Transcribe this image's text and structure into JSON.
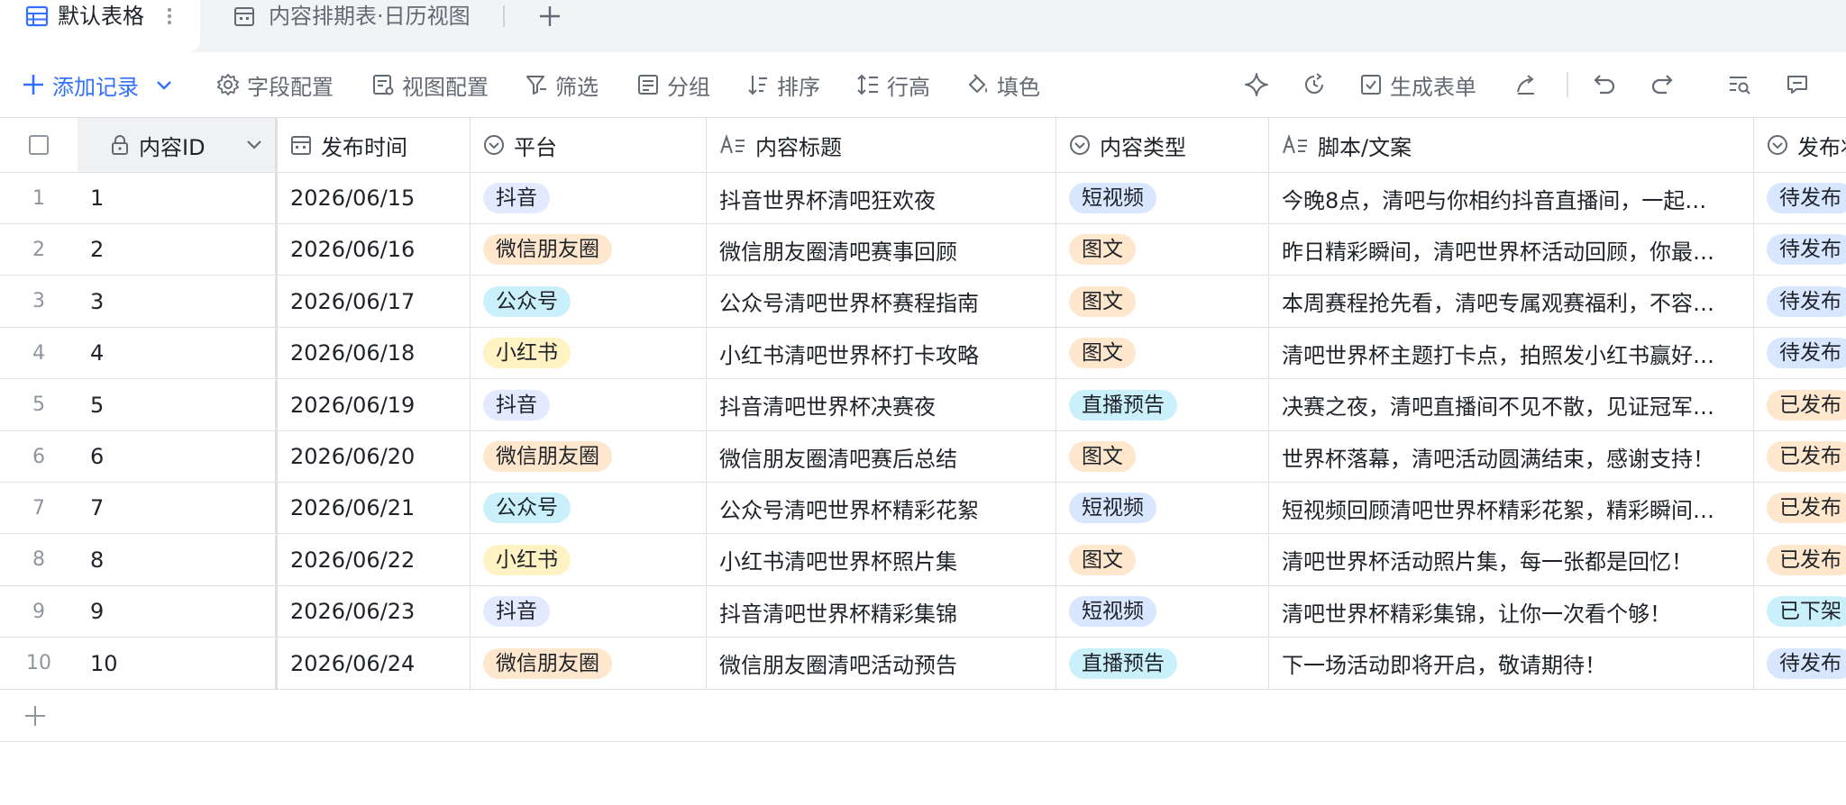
{
  "tabs": {
    "active_label": "默认表格",
    "second_label": "内容排期表·日历视图"
  },
  "toolbar": {
    "add_record": "添加记录",
    "field_config": "字段配置",
    "view_config": "视图配置",
    "filter": "筛选",
    "group": "分组",
    "sort": "排序",
    "row_height": "行高",
    "fill": "填色",
    "generate_form": "生成表单"
  },
  "columns": {
    "id": "内容ID",
    "date": "发布时间",
    "platform": "平台",
    "title": "内容标题",
    "type": "内容类型",
    "script": "脚本/文案",
    "status": "发布状态"
  },
  "colors": {
    "accent": "#3370ff",
    "tag_douyin": "#e1eaff",
    "tag_wechat": "#fee7cd",
    "tag_gzh": "#caf0fb",
    "tag_xhs": "#fff3c4"
  },
  "rows": [
    {
      "num": "1",
      "id": "1",
      "date": "2026/06/15",
      "platform": "抖音",
      "title": "抖音世界杯清吧狂欢夜",
      "type": "短视频",
      "script": "今晚8点，清吧与你相约抖音直播间，一起…",
      "status": "待发布"
    },
    {
      "num": "2",
      "id": "2",
      "date": "2026/06/16",
      "platform": "微信朋友圈",
      "title": "微信朋友圈清吧赛事回顾",
      "type": "图文",
      "script": "昨日精彩瞬间，清吧世界杯活动回顾，你最…",
      "status": "待发布"
    },
    {
      "num": "3",
      "id": "3",
      "date": "2026/06/17",
      "platform": "公众号",
      "title": "公众号清吧世界杯赛程指南",
      "type": "图文",
      "script": "本周赛程抢先看，清吧专属观赛福利，不容…",
      "status": "待发布"
    },
    {
      "num": "4",
      "id": "4",
      "date": "2026/06/18",
      "platform": "小红书",
      "title": "小红书清吧世界杯打卡攻略",
      "type": "图文",
      "script": "清吧世界杯主题打卡点，拍照发小红书赢好…",
      "status": "待发布"
    },
    {
      "num": "5",
      "id": "5",
      "date": "2026/06/19",
      "platform": "抖音",
      "title": "抖音清吧世界杯决赛夜",
      "type": "直播预告",
      "script": "决赛之夜，清吧直播间不见不散，见证冠军…",
      "status": "已发布"
    },
    {
      "num": "6",
      "id": "6",
      "date": "2026/06/20",
      "platform": "微信朋友圈",
      "title": "微信朋友圈清吧赛后总结",
      "type": "图文",
      "script": "世界杯落幕，清吧活动圆满结束，感谢支持！",
      "status": "已发布"
    },
    {
      "num": "7",
      "id": "7",
      "date": "2026/06/21",
      "platform": "公众号",
      "title": "公众号清吧世界杯精彩花絮",
      "type": "短视频",
      "script": "短视频回顾清吧世界杯精彩花絮，精彩瞬间…",
      "status": "已发布"
    },
    {
      "num": "8",
      "id": "8",
      "date": "2026/06/22",
      "platform": "小红书",
      "title": "小红书清吧世界杯照片集",
      "type": "图文",
      "script": "清吧世界杯活动照片集，每一张都是回忆！",
      "status": "已发布"
    },
    {
      "num": "9",
      "id": "9",
      "date": "2026/06/23",
      "platform": "抖音",
      "title": "抖音清吧世界杯精彩集锦",
      "type": "短视频",
      "script": "清吧世界杯精彩集锦，让你一次看个够！",
      "status": "已下架"
    },
    {
      "num": "10",
      "id": "10",
      "date": "2026/06/24",
      "platform": "微信朋友圈",
      "title": "微信朋友圈清吧活动预告",
      "type": "直播预告",
      "script": "下一场活动即将开启，敬请期待！",
      "status": "待发布"
    }
  ]
}
